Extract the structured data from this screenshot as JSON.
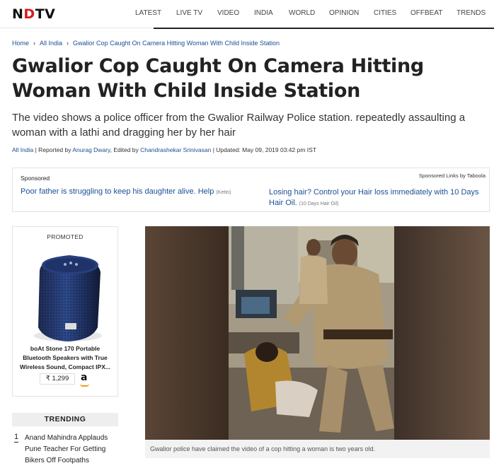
{
  "header": {
    "logo": {
      "prefix": "N",
      "accent": "D",
      "suffix": "TV"
    },
    "nav": [
      "LATEST",
      "LIVE TV",
      "VIDEO",
      "INDIA",
      "WORLD",
      "OPINION",
      "CITIES",
      "OFFBEAT",
      "TRENDS"
    ]
  },
  "breadcrumb": [
    "Home",
    "All India",
    "Gwalior Cop Caught On Camera Hitting Woman With Child Inside Station"
  ],
  "article": {
    "headline": "Gwalior Cop Caught On Camera Hitting Woman With Child Inside Station",
    "summary": "The video shows a police officer from the Gwalior Railway Police station. repeatedly assaulting a woman with a lathi and dragging her by her hair",
    "meta": {
      "section": "All India",
      "reported_prefix": " | Reported by ",
      "reporter": "Anurag Dwary",
      "edited_prefix": ", Edited by ",
      "editor": "Chandrashekar Srinivasan",
      "updated": " | Updated: May 09, 2019 03:42 pm IST"
    }
  },
  "sponsored": {
    "label": "Sponsored",
    "provider": "Sponsored Links by Taboola",
    "items": [
      {
        "text": "Poor father is struggling to keep his daughter alive. Help",
        "source": "(Ketto)"
      },
      {
        "text": "Losing hair? Control your Hair loss immediately with 10 Days Hair Oil.",
        "source": "(10 Days Hair Oil)"
      }
    ]
  },
  "promo": {
    "label": "PROMOTED",
    "title": "boAt Stone 170 Portable Bluetooth Speakers with True Wireless Sound, Compact IPX...",
    "price": "₹ 1,299",
    "store_icon": "amazon-logo"
  },
  "trending": {
    "heading": "TRENDING",
    "items": [
      {
        "num": "1",
        "text": "Anand Mahindra Applauds Pune Teacher For Getting Bikers Off Footpaths"
      }
    ]
  },
  "video": {
    "caption": "Gwalior police have claimed the video of a cop hitting a woman is two years old."
  },
  "colors": {
    "brand_red": "#d51c1c",
    "link_blue": "#1a4f95",
    "amazon_orange": "#f19a1d"
  }
}
